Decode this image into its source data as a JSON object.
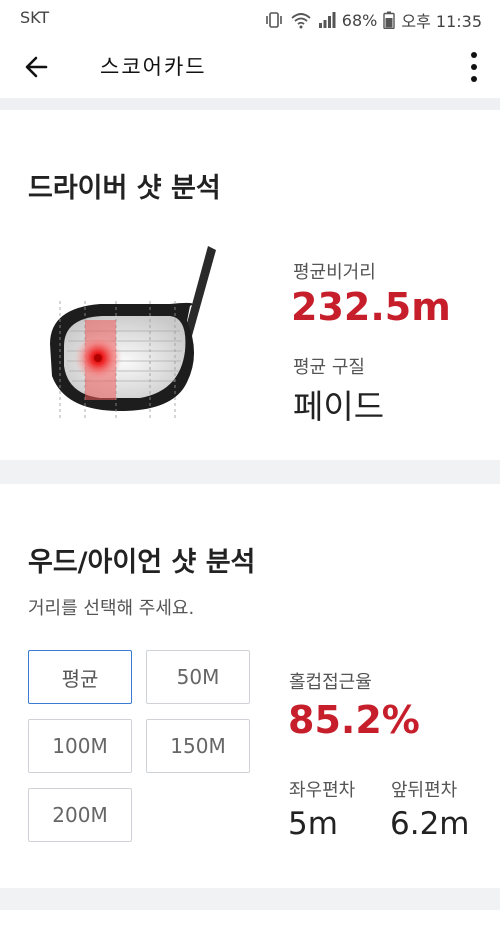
{
  "status": {
    "carrier": "SKT",
    "battery": "68%",
    "time": "오후 11:35"
  },
  "appbar": {
    "title": "스코어카드"
  },
  "driver": {
    "title": "드라이버 샷 분석",
    "avg_distance_label": "평균비거리",
    "avg_distance_value": "232.5m",
    "avg_shape_label": "평균 구질",
    "avg_shape_value": "페이드"
  },
  "wood_iron": {
    "title": "우드/아이언 샷 분석",
    "subtitle": "거리를 선택해 주세요.",
    "options": [
      "평균",
      "50M",
      "100M",
      "150M",
      "200M"
    ],
    "selected": "평균",
    "hole_approach_label": "홀컵접근율",
    "hole_approach_value": "85.2%",
    "lr_dev_label": "좌우편차",
    "lr_dev_value": "5m",
    "fb_dev_label": "앞뒤편차",
    "fb_dev_value": "6.2m"
  },
  "colors": {
    "accent_red": "#c61f2b",
    "selected_border": "#3a7bd5"
  }
}
